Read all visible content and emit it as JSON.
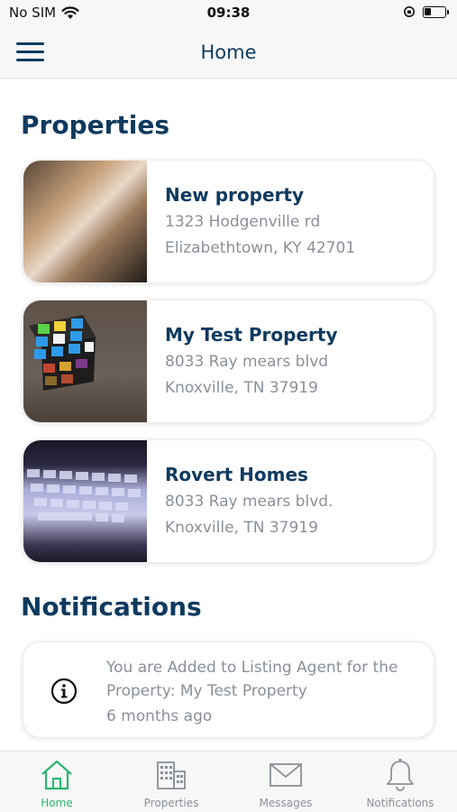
{
  "status_bar": {
    "carrier": "No SIM",
    "time": "09:38",
    "battery_level": 0.35
  },
  "header": {
    "title": "Home"
  },
  "properties_section": {
    "title": "Properties",
    "items": [
      {
        "name": "New property",
        "address_line1": "1323 Hodgenville rd",
        "address_line2": "Elizabethtown, KY 42701"
      },
      {
        "name": "My Test Property",
        "address_line1": "8033 Ray mears blvd",
        "address_line2": "Knoxville, TN 37919"
      },
      {
        "name": "Rovert Homes",
        "address_line1": "8033 Ray mears blvd.",
        "address_line2": "Knoxville, TN 37919"
      }
    ]
  },
  "notifications_section": {
    "title": "Notifications",
    "items": [
      {
        "line1": "You are Added to Listing Agent for the",
        "line2": "Property: My Test Property",
        "time": "6 months ago"
      }
    ]
  },
  "tabbar": {
    "tabs": [
      {
        "label": "Home",
        "icon": "home-icon",
        "active": true
      },
      {
        "label": "Properties",
        "icon": "building-icon",
        "active": false
      },
      {
        "label": "Messages",
        "icon": "envelope-icon",
        "active": false
      },
      {
        "label": "Notifications",
        "icon": "bell-icon",
        "active": false
      }
    ]
  },
  "colors": {
    "primary": "#0f3a5f",
    "accent": "#2bb673",
    "muted": "#8a9099"
  }
}
